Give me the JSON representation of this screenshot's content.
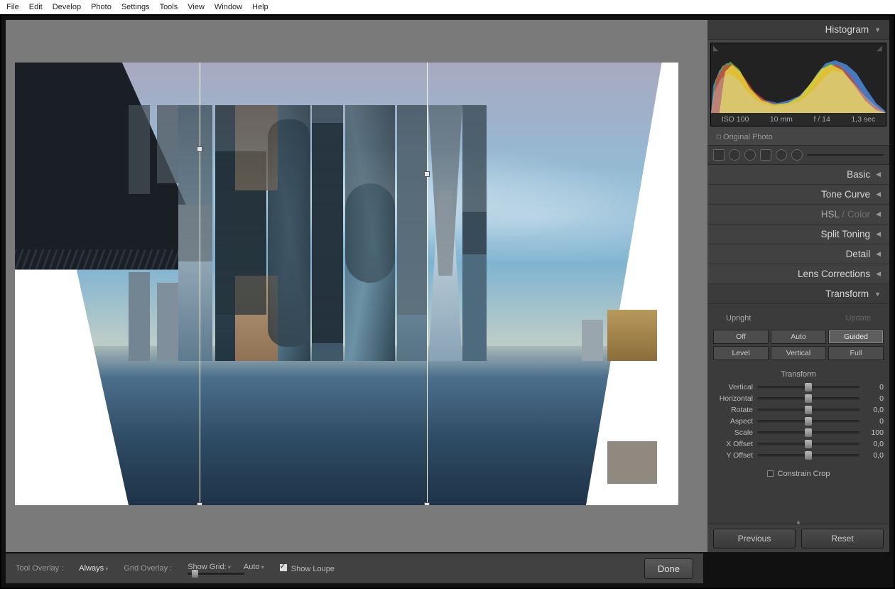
{
  "menu": {
    "items": [
      "File",
      "Edit",
      "Develop",
      "Photo",
      "Settings",
      "Tools",
      "View",
      "Window",
      "Help"
    ]
  },
  "rightPanel": {
    "histogram": {
      "title": "Histogram",
      "exif": {
        "iso": "ISO 100",
        "focal": "10 mm",
        "aperture": "f / 14",
        "shutter": "1,3 sec"
      }
    },
    "originalPhoto": "Original Photo",
    "panels": {
      "basic": "Basic",
      "toneCurve": "Tone Curve",
      "hsl": "HSL",
      "hslSep": " / ",
      "hslColor": "Color",
      "splitToning": "Split Toning",
      "detail": "Detail",
      "lensCorrections": "Lens Corrections",
      "transform": "Transform"
    },
    "transform": {
      "upright": "Upright",
      "update": "Update",
      "buttons": {
        "off": "Off",
        "auto": "Auto",
        "guided": "Guided",
        "level": "Level",
        "vertical": "Vertical",
        "full": "Full"
      },
      "sectionTitle": "Transform",
      "sliders": [
        {
          "label": "Vertical",
          "value": "0",
          "pos": 50
        },
        {
          "label": "Horizontal",
          "value": "0",
          "pos": 50
        },
        {
          "label": "Rotate",
          "value": "0,0",
          "pos": 50
        },
        {
          "label": "Aspect",
          "value": "0",
          "pos": 50
        },
        {
          "label": "Scale",
          "value": "100",
          "pos": 50
        },
        {
          "label": "X Offset",
          "value": "0,0",
          "pos": 50
        },
        {
          "label": "Y Offset",
          "value": "0,0",
          "pos": 50
        }
      ],
      "constrainCrop": "Constrain Crop"
    },
    "previous": "Previous",
    "reset": "Reset"
  },
  "bottombar": {
    "toolOverlayLabel": "Tool Overlay :",
    "toolOverlayValue": "Always",
    "gridOverlayLabel": "Grid Overlay :",
    "showGrid": "Show Grid:",
    "auto": "Auto",
    "showLoupe": "Show Loupe",
    "done": "Done"
  }
}
